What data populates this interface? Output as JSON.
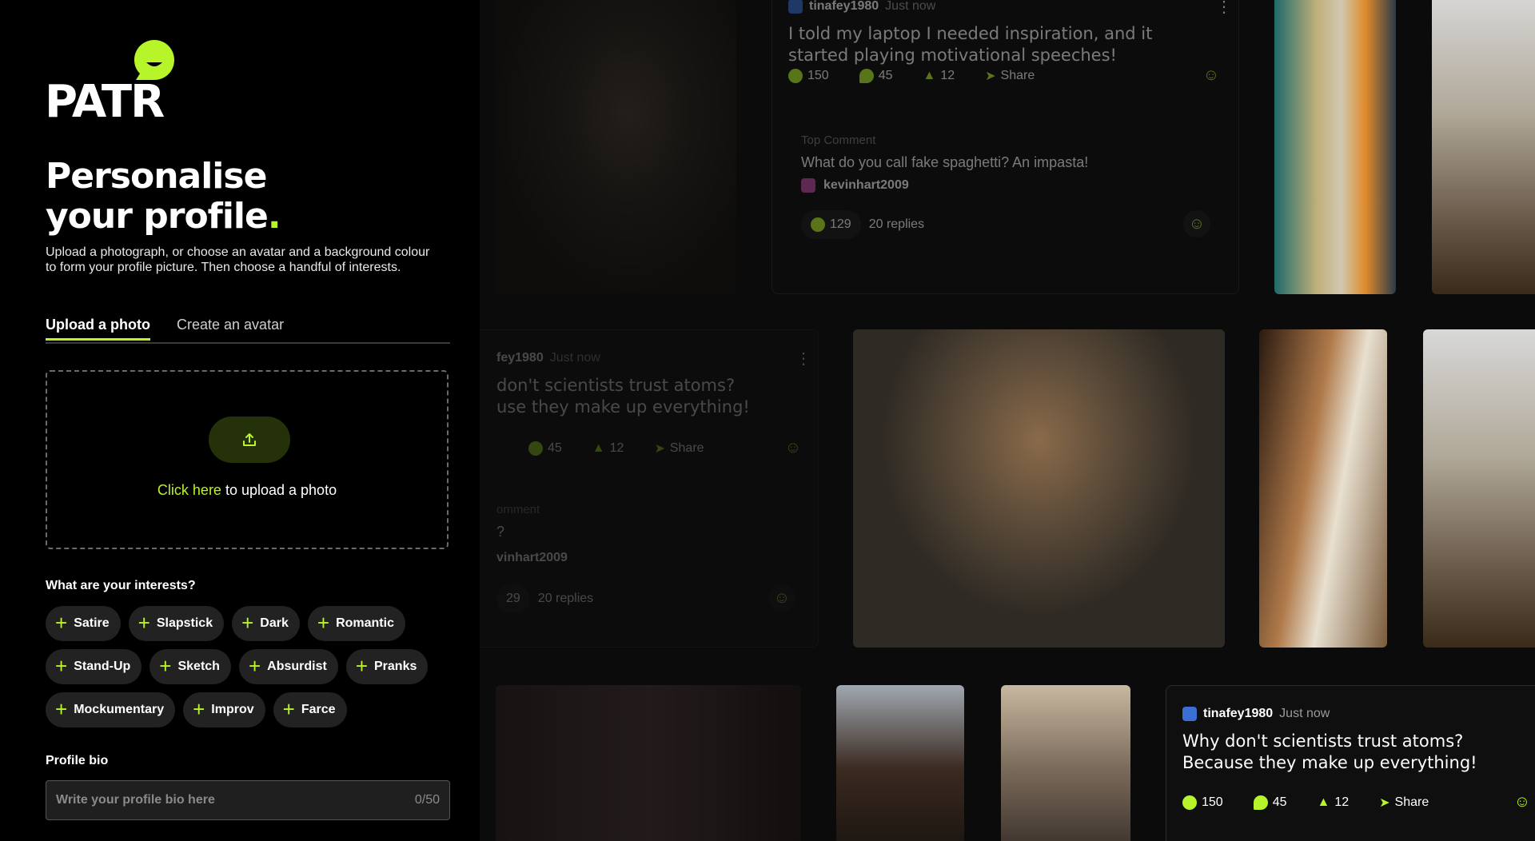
{
  "brand": {
    "name": "PATR",
    "accent": "#b8f42a"
  },
  "profile": {
    "title_line1": "Personalise",
    "title_line2": "your profile",
    "title_dot": ".",
    "description": "Upload a photograph, or choose an avatar and a background colour to form your profile picture. Then choose a handful of interests."
  },
  "tabs": {
    "upload": "Upload a photo",
    "avatar": "Create an avatar"
  },
  "upload": {
    "link": "Click here",
    "rest": " to upload a photo",
    "icon": "upload-icon"
  },
  "interests": {
    "label": "What are your interests?",
    "rows": [
      [
        "Satire",
        "Slapstick",
        "Dark",
        "Romantic"
      ],
      [
        "Stand-Up",
        "Sketch",
        "Absurdist",
        "Pranks"
      ],
      [
        "Mockumentary",
        "Improv",
        "Farce"
      ]
    ]
  },
  "bio": {
    "label": "Profile bio",
    "placeholder": "Write your profile bio here",
    "count": "0/50"
  },
  "feed": {
    "card_top": {
      "user": "tinafey1980",
      "time": "Just now",
      "title": "I told my laptop I needed inspiration, and it started playing motivational speeches!",
      "laughs": "150",
      "comments": "45",
      "upvotes": "12",
      "share": "Share",
      "top_comment_label": "Top Comment",
      "top_comment": "What do you call fake spaghetti? An impasta!",
      "commenter": "kevinhart2009",
      "comment_laughs": "129",
      "replies": "20 replies"
    },
    "card_mid": {
      "user": "fey1980",
      "time": "Just now",
      "title_line1": "don't scientists trust atoms?",
      "title_line2": "use they make up everything!",
      "laughs": "45",
      "upvotes": "12",
      "share": "Share",
      "top_comment_label": "omment",
      "top_comment": "?",
      "commenter": "vinhart2009",
      "comment_laughs": "29",
      "replies": "20 replies"
    },
    "card_bottom": {
      "user": "tinafey1980",
      "time": "Just now",
      "title_line1": "Why don't scientists trust atoms?",
      "title_line2": "Because they make up everything!",
      "laughs": "150",
      "comments": "45",
      "upvotes": "12",
      "share": "Share"
    }
  }
}
